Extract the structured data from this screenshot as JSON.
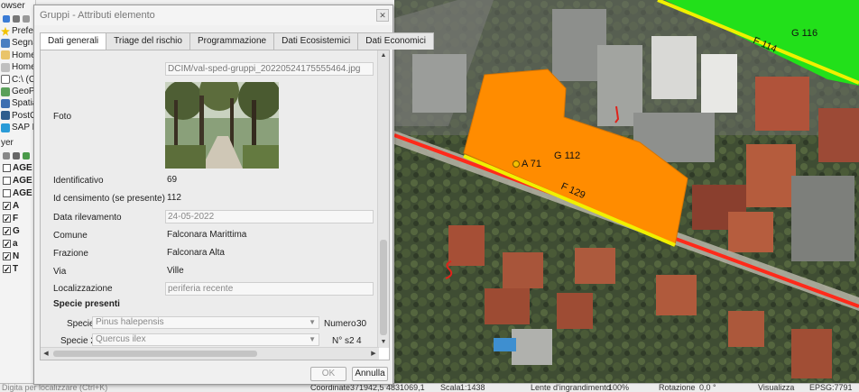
{
  "browser_panel": {
    "title": "owser",
    "items": [
      {
        "label": "Prefer",
        "icon": "star-icon"
      },
      {
        "label": "Segna",
        "icon": "bookmark-icon"
      },
      {
        "label": "Home",
        "icon": "home-folder-icon"
      },
      {
        "label": "Home",
        "icon": "home-folder-icon"
      },
      {
        "label": "C:\\ (C",
        "icon": "drive-icon"
      },
      {
        "label": "GeoPa",
        "icon": "geopackage-icon"
      },
      {
        "label": "Spatia",
        "icon": "spatialite-icon"
      },
      {
        "label": "PostG",
        "icon": "postgis-icon"
      },
      {
        "label": "SAP H",
        "icon": "database-icon"
      }
    ]
  },
  "layers_panel": {
    "title": "yer",
    "items": [
      {
        "label": "AGE",
        "checked": false
      },
      {
        "label": "AGE",
        "checked": false
      },
      {
        "label": "AGE",
        "checked": false
      },
      {
        "label": "A",
        "checked": true
      },
      {
        "label": "F",
        "checked": true
      },
      {
        "label": "G",
        "checked": true
      },
      {
        "label": "a",
        "checked": true
      },
      {
        "label": "N",
        "checked": true
      },
      {
        "label": "T",
        "checked": true
      }
    ]
  },
  "dialog": {
    "title": "Gruppi - Attributi elemento",
    "close_glyph": "✕",
    "tabs": [
      {
        "label": "Dati generali",
        "active": true
      },
      {
        "label": "Triage del rischio",
        "active": false
      },
      {
        "label": "Programmazione",
        "active": false
      },
      {
        "label": "Dati Ecosistemici",
        "active": false
      },
      {
        "label": "Dati Economici",
        "active": false
      }
    ],
    "photo_path": "DCIM/val-sped-gruppi_20220524175555464.jpg",
    "fields": {
      "foto_label": "Foto",
      "identificativo_label": "Identificativo",
      "identificativo_value": "69",
      "id_censimento_label": "Id censimento (se presente)",
      "id_censimento_value": "112",
      "data_rilevamento_label": "Data rilevamento",
      "data_rilevamento_value": "24-05-2022",
      "comune_label": "Comune",
      "comune_value": "Falconara Marittima",
      "frazione_label": "Frazione",
      "frazione_value": "Falconara Alta",
      "via_label": "Via",
      "via_value": "Ville",
      "localizzazione_label": "Localizzazione",
      "localizzazione_value": "periferia recente"
    },
    "species": {
      "section_title": "Specie presenti",
      "specie_label": "Specie",
      "specie_value": "Pinus halepensis",
      "numero_label": "Numero",
      "numero_value": "30",
      "specie2_label": "Specie 2",
      "specie2_value": "Quercus ilex",
      "ns2_label": "N° s2",
      "ns2_value": "4"
    },
    "buttons": {
      "ok": "OK",
      "cancel": "Annulla"
    }
  },
  "map": {
    "labels": {
      "g116": "G 116",
      "f114": "F 114",
      "g112": "G 112",
      "a71": "A 71",
      "f129": "F 129"
    },
    "colors": {
      "polygon_fill": "#ff8c00",
      "green_area": "#22e01a",
      "yellow_line": "#f0f000",
      "red_line": "#ff2a1a"
    }
  },
  "statusbar": {
    "coords_hint": "Digita per localizzare (Ctrl+K)",
    "coordinate_label": "Coordinate",
    "coordinate_value": "371942,5 4831069,1",
    "scale_label": "Scala",
    "scale_value": "1:1438",
    "magnifier_label": "Lente d'ingrandimento",
    "magnifier_value": "100%",
    "rotation_label": "Rotazione",
    "rotation_value": "0,0 °",
    "render_label": "Visualizza",
    "crs_value": "EPSG:7791"
  }
}
